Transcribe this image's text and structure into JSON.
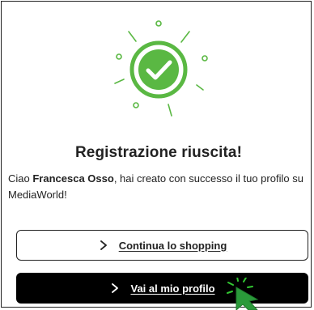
{
  "success": {
    "title": "Registrazione riuscita!",
    "greeting_prefix": "Ciao ",
    "user_name": "Francesca Osso",
    "greeting_suffix": ", hai creato con successo il tuo profilo su MediaWorld!"
  },
  "actions": {
    "continue_label": "Continua lo shopping",
    "profile_label": "Vai al mio profilo"
  },
  "colors": {
    "success_green": "#5ab843",
    "primary_button": "#000000",
    "text": "#222222",
    "cursor_highlight": "#32c832"
  },
  "icons": [
    "checkmark-success-icon",
    "chevron-right-icon",
    "pointer-cursor-icon"
  ]
}
